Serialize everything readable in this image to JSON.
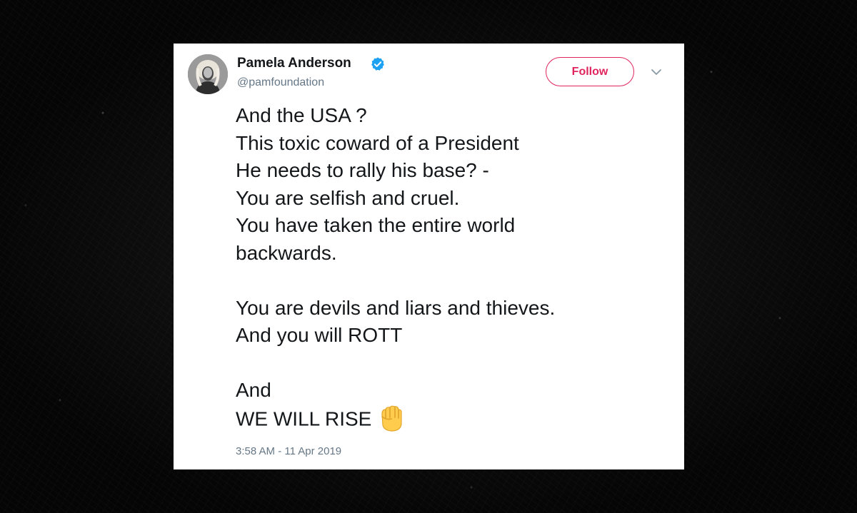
{
  "tweet": {
    "display_name": "Pamela Anderson",
    "handle": "@pamfoundation",
    "follow_label": "Follow",
    "lines": [
      "And the USA ?",
      "This toxic coward of a President",
      "He needs to rally his base? -",
      "You are selfish and cruel.",
      "You have taken the entire world",
      "backwards.",
      "",
      "You are devils and liars and thieves.",
      "And you will ROTT",
      "",
      "And",
      "WE WILL RISE"
    ],
    "timestamp": "3:58 AM - 11 Apr 2019",
    "icons": {
      "verified": "verified-badge-icon",
      "menu": "chevron-down-icon",
      "emoji": "raised-fist-icon"
    }
  },
  "colors": {
    "follow_accent": "#e0245e",
    "verified_blue": "#1da1f2",
    "text_primary": "#14171a",
    "text_secondary": "#657786",
    "card_background": "#ffffff",
    "page_background": "#0b0b0b"
  }
}
